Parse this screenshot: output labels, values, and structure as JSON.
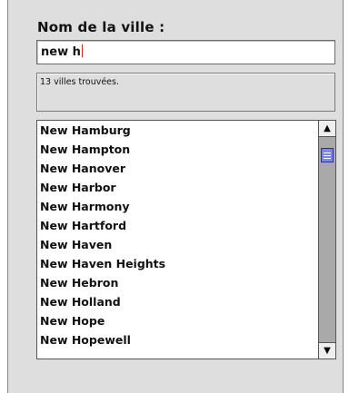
{
  "city_label": "Nom de la ville :",
  "search": {
    "value": "new h"
  },
  "status": {
    "text": "13 villes trouvées."
  },
  "results": [
    "New Hamburg",
    "New Hampton",
    "New Hanover",
    "New Harbor",
    "New Harmony",
    "New Hartford",
    "New Haven",
    "New Haven Heights",
    "New Hebron",
    "New Holland",
    "New Hope",
    "New Hopewell"
  ],
  "scrollbar": {
    "position_fraction": 0.05
  },
  "icons": {
    "scroll_up": "arrow-up-icon",
    "scroll_down": "arrow-down-icon"
  },
  "colors": {
    "caret": "#d2261d",
    "scroll_thumb": "#7c86e8"
  }
}
